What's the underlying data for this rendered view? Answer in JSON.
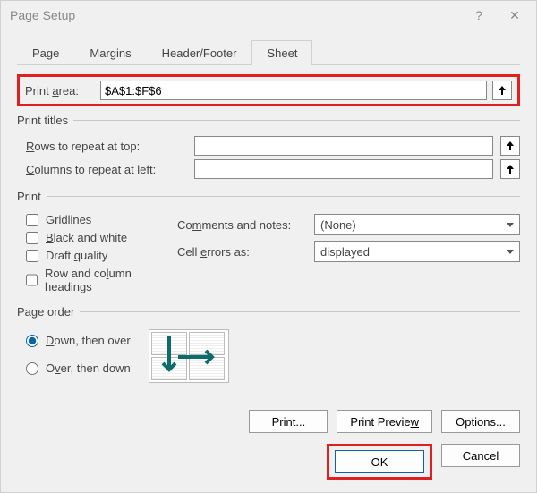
{
  "titlebar": {
    "title": "Page Setup",
    "help": "?",
    "close": "✕"
  },
  "tabs": {
    "items": [
      "Page",
      "Margins",
      "Header/Footer",
      "Sheet"
    ],
    "active": 3
  },
  "printArea": {
    "label": "Print area:",
    "value": "$A$1:$F$6"
  },
  "printTitles": {
    "legend": "Print titles",
    "rowsLabel": "Rows to repeat at top:",
    "rowsValue": "",
    "colsLabel": "Columns to repeat at left:",
    "colsValue": ""
  },
  "print": {
    "legend": "Print",
    "gridlines": "Gridlines",
    "bw": "Black and white",
    "draft": "Draft quality",
    "rowcol": "Row and column headings",
    "commentsLabel": "Comments and notes:",
    "commentsValue": "(None)",
    "errorsLabel": "Cell errors as:",
    "errorsValue": "displayed"
  },
  "order": {
    "legend": "Page order",
    "down": "Down, then over",
    "over": "Over, then down"
  },
  "buttons": {
    "print": "Print...",
    "preview": "Print Preview",
    "options": "Options...",
    "ok": "OK",
    "cancel": "Cancel"
  }
}
